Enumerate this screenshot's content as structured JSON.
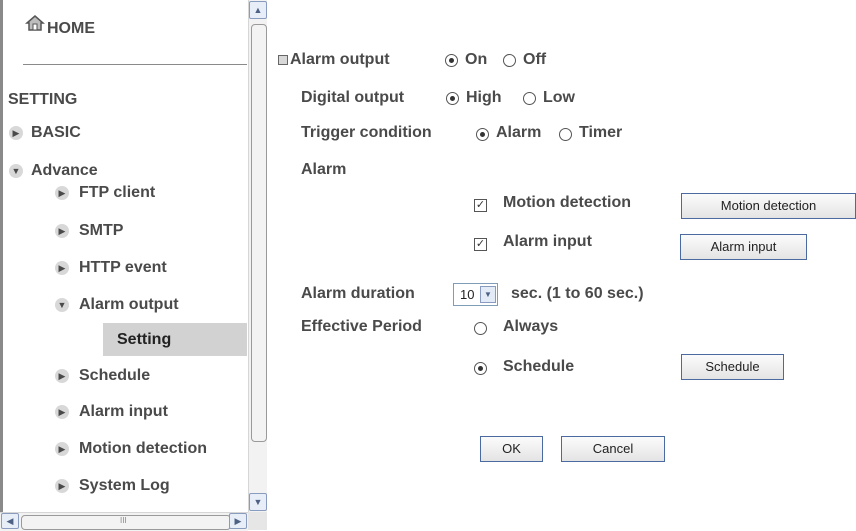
{
  "sidebar": {
    "home_label": "HOME",
    "setting_label": "SETTING",
    "basic_label": "BASIC",
    "advance_label": "Advance",
    "items": {
      "ftp": "FTP client",
      "smtp": "SMTP",
      "http": "HTTP event",
      "alarm_output": "Alarm output",
      "setting": "Setting",
      "schedule": "Schedule",
      "alarm_input": "Alarm input",
      "motion": "Motion detection",
      "system_log": "System Log"
    },
    "icons": {
      "home": "home-icon",
      "collapsed": "triangle-right-icon",
      "expanded": "triangle-down-icon"
    }
  },
  "form": {
    "alarm_output_label": "Alarm output",
    "alarm_output_on": "On",
    "alarm_output_off": "Off",
    "digital_output_label": "Digital output",
    "digital_high": "High",
    "digital_low": "Low",
    "trigger_label": "Trigger condition",
    "trigger_alarm": "Alarm",
    "trigger_timer": "Timer",
    "alarm_section_label": "Alarm",
    "motion_detection_label": "Motion detection",
    "motion_detection_button": "Motion detection",
    "alarm_input_label": "Alarm input",
    "alarm_input_button": "Alarm input",
    "alarm_duration_label": "Alarm duration",
    "alarm_duration_value": "10",
    "alarm_duration_suffix": "sec. (1 to 60 sec.)",
    "effective_period_label": "Effective Period",
    "period_always": "Always",
    "period_schedule": "Schedule",
    "schedule_button": "Schedule",
    "ok_button": "OK",
    "cancel_button": "Cancel"
  }
}
